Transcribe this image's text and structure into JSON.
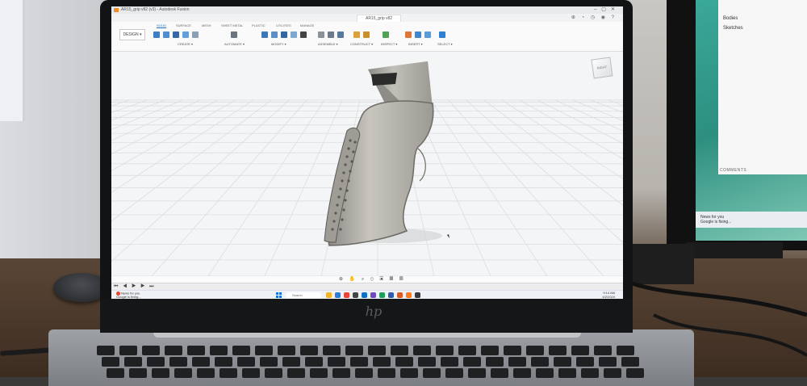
{
  "app": {
    "title": "AR15_grip v82 (v3) - Autodesk Fusion",
    "doc_tab": "AR15_grip v82",
    "workspace": "DESIGN ▾"
  },
  "ribbon": {
    "tabs": [
      "SOLID",
      "SURFACE",
      "MESH",
      "SHEET METAL",
      "PLASTIC",
      "UTILITIES",
      "MANAGE"
    ],
    "groups": [
      "CREATE ▾",
      "AUTOMATE ▾",
      "MODIFY ▾",
      "ASSEMBLE ▾",
      "CONSTRUCT ▾",
      "INSPECT ▾",
      "INSERT ▾",
      "SELECT ▾"
    ]
  },
  "viewcube": {
    "label": "RIGHT"
  },
  "taskbar": {
    "news_title": "News for you",
    "news_sub": "Google is fixing...",
    "search_placeholder": "Search",
    "time": "9:14 AM",
    "date": "4/2/2024"
  },
  "monitor": {
    "panel_rows": [
      "Bodies",
      "Sketches"
    ],
    "comments_label": "COMMENTS",
    "news_title": "News for you",
    "news_sub": "Google is fixing..."
  },
  "laptop": {
    "brand": "hp"
  },
  "colors": {
    "accent": "#1f6fb5",
    "grip": "#b9b5ae",
    "grid": "#d8dadc",
    "canvas_bg": "#f4f5f6"
  }
}
